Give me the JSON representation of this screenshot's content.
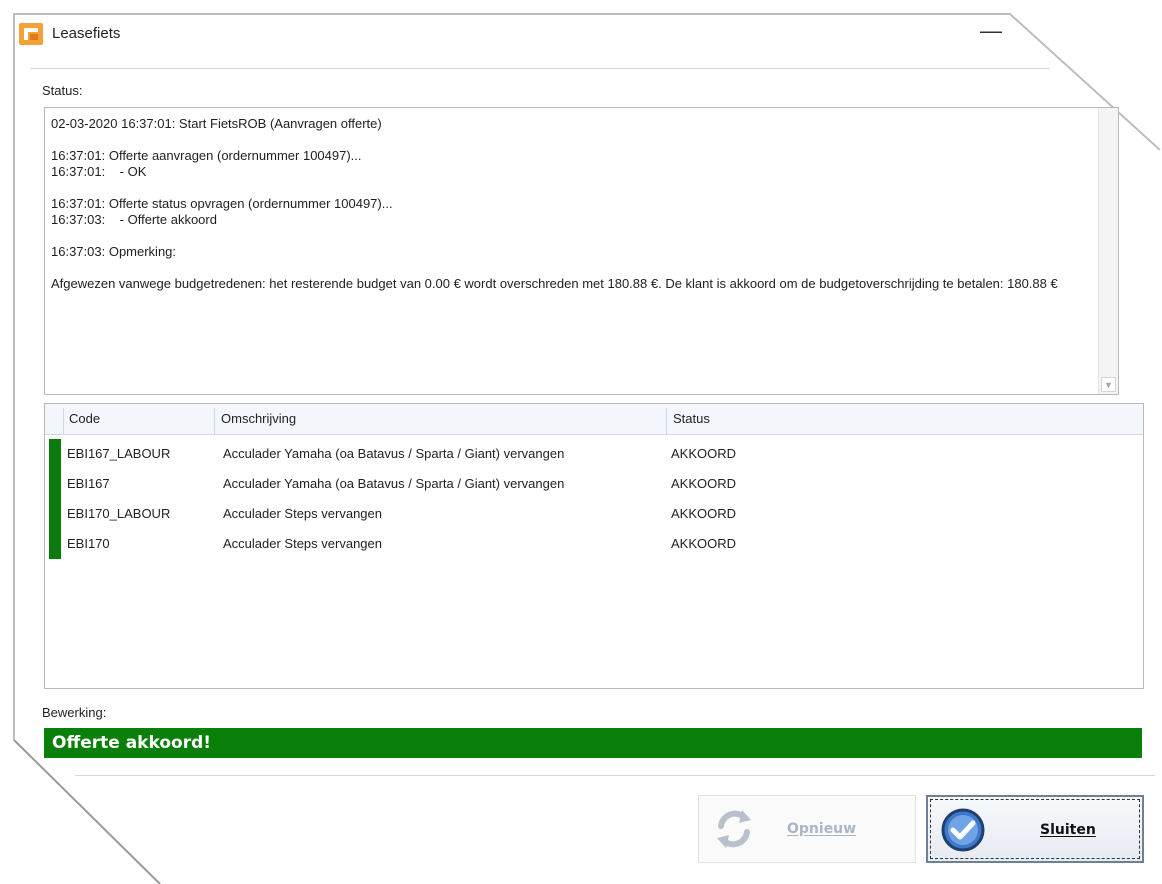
{
  "window": {
    "title": "Leasefiets",
    "minimize_label": "—"
  },
  "status": {
    "label": "Status:",
    "log": "02-03-2020 16:37:01: Start FietsROB (Aanvragen offerte)\n\n16:37:01: Offerte aanvragen (ordernummer 100497)...\n16:37:01:    - OK\n\n16:37:01: Offerte status opvragen (ordernummer 100497)...\n16:37:03:    - Offerte akkoord\n\n16:37:03: Opmerking:\n\nAfgewezen vanwege budgetredenen: het resterende budget van 0.00 € wordt overschreden met 180.88 €. De klant is akkoord om de budgetoverschrijding te betalen: 180.88 €"
  },
  "grid": {
    "columns": [
      "Code",
      "Omschrijving",
      "Status"
    ],
    "rows": [
      {
        "code": "EBI167_LABOUR",
        "omschrijving": "Acculader Yamaha (oa Batavus / Sparta / Giant) vervangen",
        "status": "AKKOORD"
      },
      {
        "code": "EBI167",
        "omschrijving": "Acculader Yamaha (oa Batavus / Sparta / Giant) vervangen",
        "status": "AKKOORD"
      },
      {
        "code": "EBI170_LABOUR",
        "omschrijving": "Acculader Steps vervangen",
        "status": "AKKOORD"
      },
      {
        "code": "EBI170",
        "omschrijving": "Acculader Steps vervangen",
        "status": "AKKOORD"
      }
    ],
    "row_marker_color": "#0d7a0d"
  },
  "bewerking": {
    "label": "Bewerking:",
    "result": "Offerte akkoord!",
    "result_color": "#0a7f0a"
  },
  "buttons": {
    "retry": {
      "label": "Opnieuw",
      "icon": "refresh-icon",
      "enabled": false
    },
    "close": {
      "label": "Sluiten",
      "icon": "checkmark-icon",
      "enabled": true
    }
  }
}
